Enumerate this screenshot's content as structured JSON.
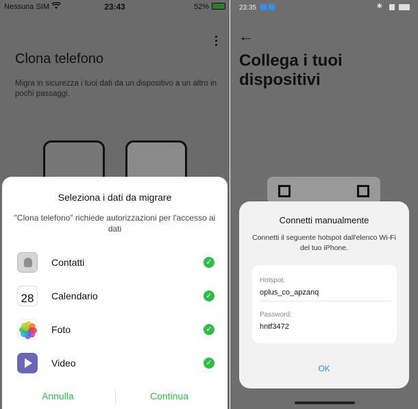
{
  "left_phone": {
    "status_bar": {
      "carrier": "Nessuna SIM",
      "time": "23:43",
      "battery": "52%"
    },
    "page_title": "Clona telefono",
    "page_subtitle": "Migra in sicurezza i tuoi dati da un dispositivo a un altro in pochi passaggi.",
    "sheet": {
      "title": "Seleziona i dati da migrare",
      "description": "\"Clona telefono\" richiede autorizzazioni per l'accesso ai dati",
      "items": [
        {
          "label": "Contatti",
          "icon": "contacts-app-icon",
          "checked": true
        },
        {
          "label": "Calendario",
          "icon": "calendar-app-icon",
          "checked": true,
          "calendar_day": "28"
        },
        {
          "label": "Foto",
          "icon": "photos-app-icon",
          "checked": true
        },
        {
          "label": "Video",
          "icon": "video-app-icon",
          "checked": true
        }
      ],
      "cancel_label": "Annulla",
      "continue_label": "Continua"
    },
    "accent_color": "#2fbd48"
  },
  "right_phone": {
    "status_bar": {
      "time": "23:35"
    },
    "page_title": "Collega i tuoi dispositivi",
    "dialog": {
      "title": "Connetti manualmente",
      "description": "Connetti il seguente hotspot dall'elenco Wi-Fi del tuo iPhone.",
      "hotspot_label": "Hotspot:",
      "hotspot_value": "oplus_co_apzanq",
      "password_label": "Password:",
      "password_value": "hntf3472",
      "ok_label": "OK"
    },
    "accent_color": "#2e8ef5"
  }
}
